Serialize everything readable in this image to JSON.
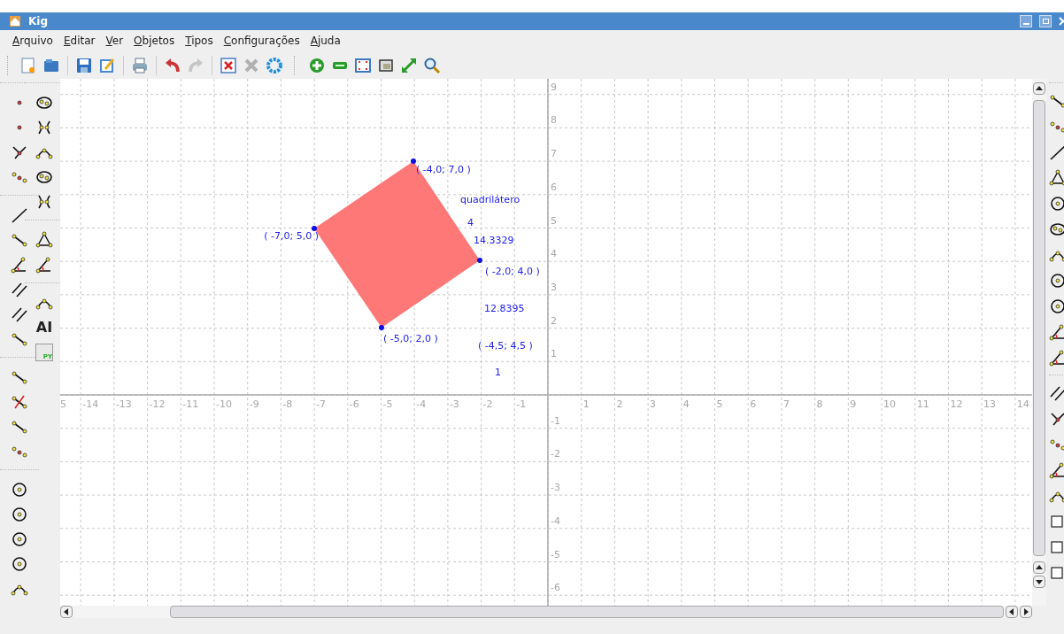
{
  "window": {
    "title": "Kig"
  },
  "menu": [
    "Arquivo",
    "Editar",
    "Ver",
    "Objetos",
    "Tipos",
    "Configurações",
    "Ajuda"
  ],
  "toolbar": [
    {
      "kind": "new",
      "disabled": false
    },
    {
      "kind": "open",
      "disabled": false
    },
    {
      "kind": "sep"
    },
    {
      "kind": "save",
      "disabled": false
    },
    {
      "kind": "saveas",
      "disabled": false
    },
    {
      "kind": "sep"
    },
    {
      "kind": "print",
      "disabled": false
    },
    {
      "kind": "sep"
    },
    {
      "kind": "undo",
      "disabled": false
    },
    {
      "kind": "redo",
      "disabled": true
    },
    {
      "kind": "sep"
    },
    {
      "kind": "delete",
      "disabled": false
    },
    {
      "kind": "cancel",
      "disabled": true
    },
    {
      "kind": "settings",
      "disabled": false
    },
    {
      "kind": "grip"
    },
    {
      "kind": "zoomin",
      "disabled": false
    },
    {
      "kind": "zoomout",
      "disabled": false
    },
    {
      "kind": "fit",
      "disabled": false
    },
    {
      "kind": "view",
      "disabled": false
    },
    {
      "kind": "resize",
      "disabled": false
    },
    {
      "kind": "search",
      "disabled": false
    }
  ],
  "text_tool_label": "AI",
  "script_tool_label": "PY",
  "canvas": {
    "x_axis_labels": [
      "5",
      "-14",
      "-13",
      "-12",
      "-11",
      "-10",
      "-9",
      "-8",
      "-7",
      "-6",
      "-5",
      "-4",
      "-3",
      "-2",
      "-1",
      "1",
      "2",
      "3",
      "4",
      "5",
      "6",
      "7",
      "8",
      "9",
      "10",
      "11",
      "12",
      "13",
      "14"
    ],
    "y_axis_labels": [
      "9",
      "8",
      "7",
      "6",
      "5",
      "4",
      "3",
      "2",
      "1",
      "-1",
      "-2",
      "-3",
      "-4",
      "-5",
      "-6"
    ],
    "points": [
      {
        "label": "( -4,0; 7,0 )"
      },
      {
        "label": "( -7,0; 5,0 )"
      },
      {
        "label": "( -2,0; 4,0 )"
      },
      {
        "label": "( -5,0; 2,0 )"
      }
    ],
    "labels": [
      "quadrilátero",
      "4",
      "14.3329",
      "12.8395",
      "( -4,5; 4,5 )",
      "1"
    ]
  }
}
